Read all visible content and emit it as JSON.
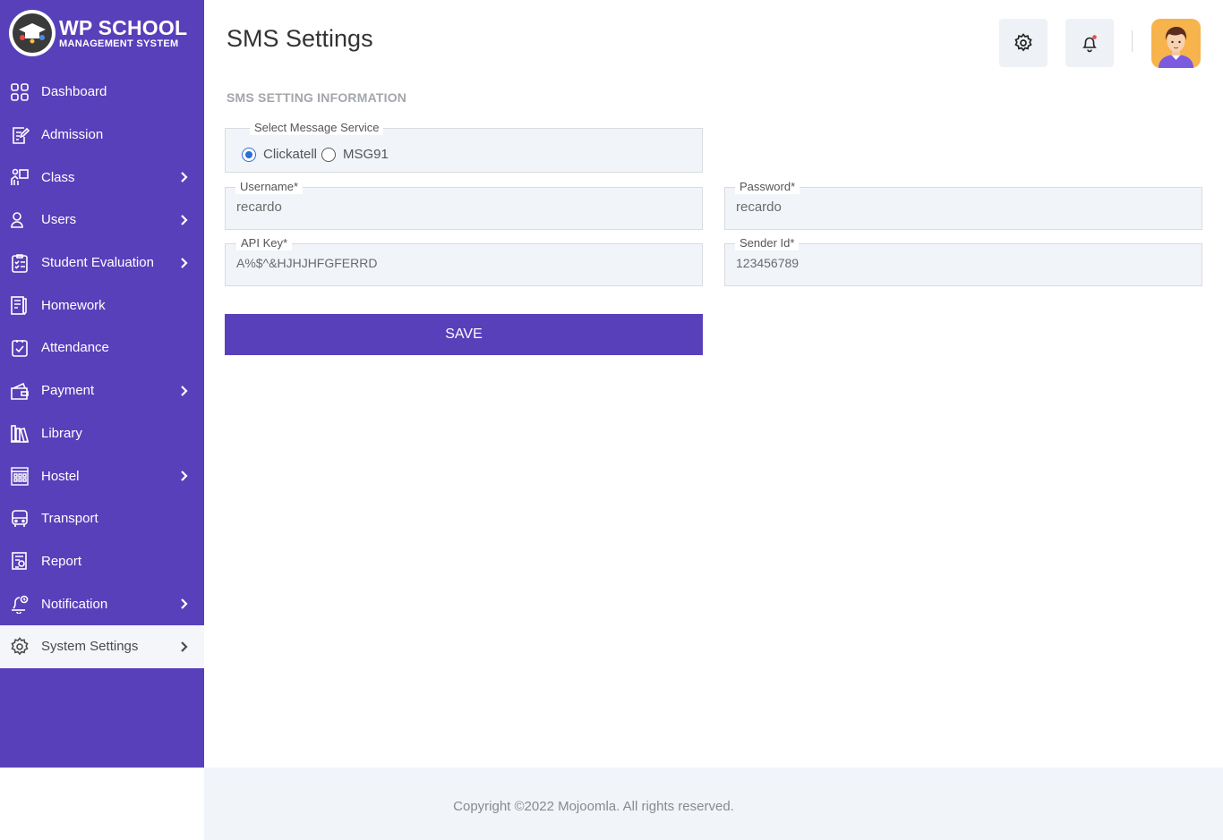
{
  "brand": {
    "title": "WP SCHOOL",
    "subtitle": "MANAGEMENT SYSTEM"
  },
  "sidebar": {
    "items": [
      {
        "label": "Dashboard",
        "icon": "dashboard-icon",
        "has_submenu": false
      },
      {
        "label": "Admission",
        "icon": "admission-icon",
        "has_submenu": false
      },
      {
        "label": "Class",
        "icon": "class-icon",
        "has_submenu": true
      },
      {
        "label": "Users",
        "icon": "user-icon",
        "has_submenu": true
      },
      {
        "label": "Student Evaluation",
        "icon": "evaluation-icon",
        "has_submenu": true
      },
      {
        "label": "Homework",
        "icon": "homework-icon",
        "has_submenu": false
      },
      {
        "label": "Attendance",
        "icon": "attendance-icon",
        "has_submenu": false
      },
      {
        "label": "Payment",
        "icon": "wallet-icon",
        "has_submenu": true
      },
      {
        "label": "Library",
        "icon": "library-icon",
        "has_submenu": false
      },
      {
        "label": "Hostel",
        "icon": "hostel-icon",
        "has_submenu": true
      },
      {
        "label": "Transport",
        "icon": "bus-icon",
        "has_submenu": false
      },
      {
        "label": "Report",
        "icon": "report-icon",
        "has_submenu": false
      },
      {
        "label": "Notification",
        "icon": "notification-icon",
        "has_submenu": true
      },
      {
        "label": "System Settings",
        "icon": "gear-icon",
        "has_submenu": true,
        "active": true
      }
    ]
  },
  "header": {
    "title": "SMS Settings"
  },
  "form": {
    "section_title": "SMS SETTING INFORMATION",
    "service": {
      "label": "Select Message Service",
      "options": [
        "Clickatell",
        "MSG91"
      ],
      "selected": "Clickatell"
    },
    "username": {
      "label": "Username*",
      "value": "recardo"
    },
    "password": {
      "label": "Password*",
      "value": "recardo"
    },
    "api_key": {
      "label": "API Key*",
      "value": "A%$^&HJHJHFGFERRD"
    },
    "sender_id": {
      "label": "Sender Id*",
      "value": "123456789"
    },
    "save_label": "SAVE"
  },
  "footer": {
    "text": "Copyright ©2022 Mojoomla. All rights reserved."
  },
  "colors": {
    "sidebar": "#5840bb",
    "accent": "#5840bb",
    "radio": "#2f6fd2",
    "notification_dot": "#e84a4a"
  }
}
